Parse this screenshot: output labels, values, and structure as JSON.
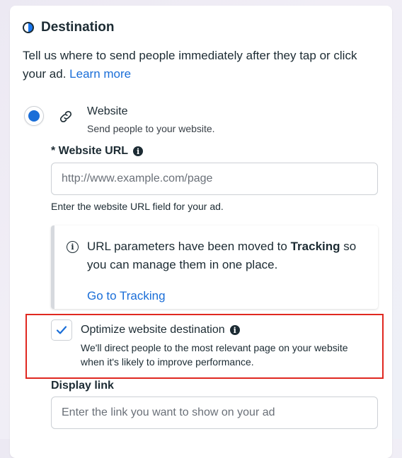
{
  "destination": {
    "title": "Destination",
    "description": "Tell us where to send people immediately after they tap or click your ad.",
    "learn_more": "Learn more"
  },
  "website_option": {
    "title": "Website",
    "subtitle": "Send people to your website.",
    "selected": true
  },
  "website_url": {
    "label": "* Website URL",
    "placeholder": "http://www.example.com/page",
    "value": "",
    "helper": "Enter the website URL field for your ad."
  },
  "tracking_notice": {
    "text_before": "URL parameters have been moved to ",
    "text_bold": "Tracking",
    "text_after": " so you can manage them in one place.",
    "link": "Go to Tracking"
  },
  "optimize": {
    "checked": true,
    "title": "Optimize website destination",
    "description": "We'll direct people to the most relevant page on your website when it's likely to improve performance."
  },
  "display_link": {
    "label": "Display link",
    "placeholder": "Enter the link you want to show on your ad",
    "value": ""
  },
  "colors": {
    "accent": "#1a6ed8",
    "highlight_border": "#e02820"
  },
  "icons": {
    "header": "half-circle-icon",
    "website": "link-icon",
    "info": "info-icon",
    "notice": "info-circle-icon",
    "check": "check-icon"
  }
}
